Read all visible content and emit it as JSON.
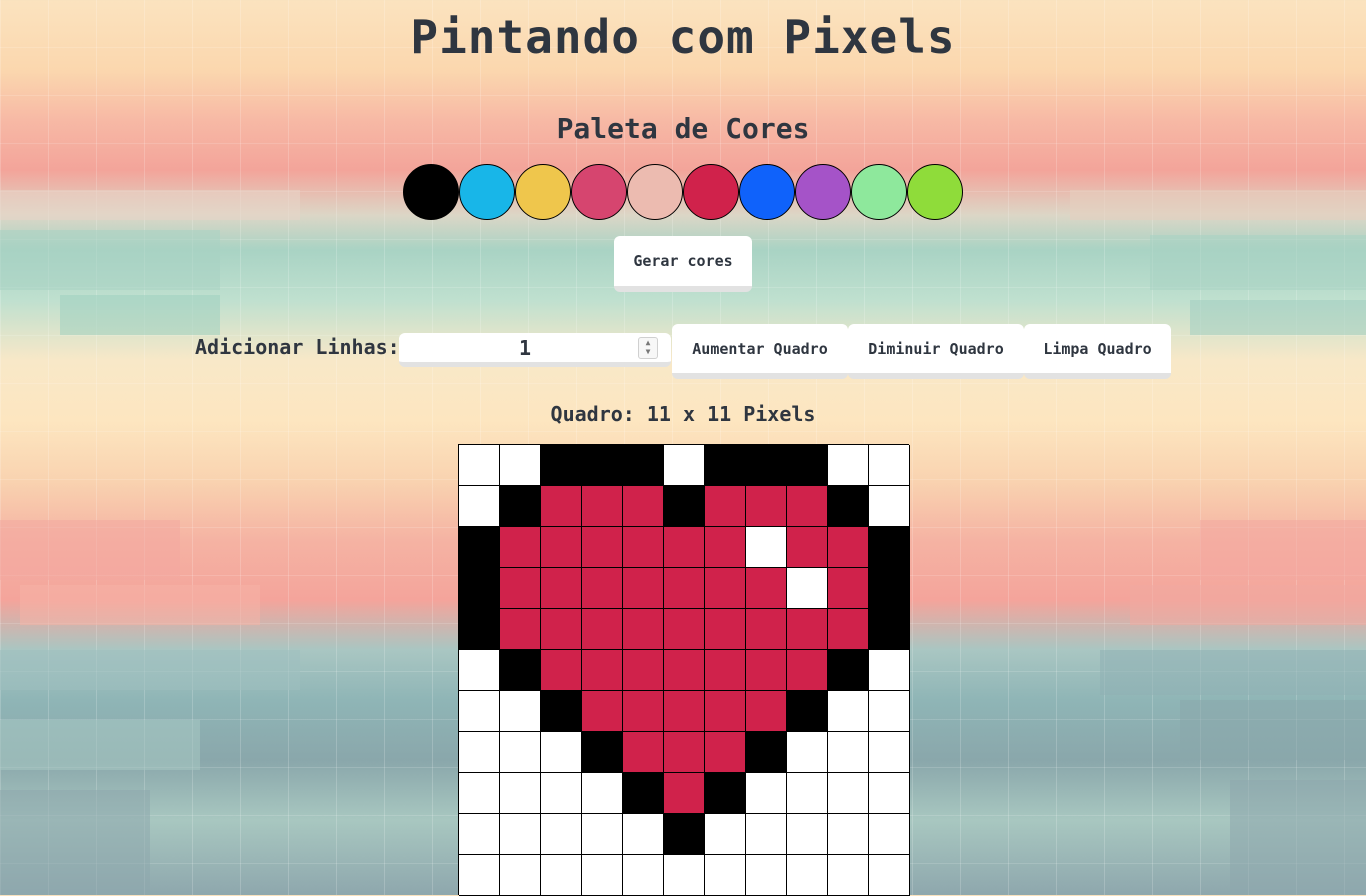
{
  "page_title": "Pintando com Pixels",
  "palette": {
    "title": "Paleta de Cores",
    "colors": [
      "#000000",
      "#18b6e8",
      "#efc64c",
      "#d6456f",
      "#ecbbb0",
      "#d0224b",
      "#0f62fb",
      "#a553c8",
      "#8ee89c",
      "#8fdc3a"
    ]
  },
  "generate_button_label": "Gerar cores",
  "controls": {
    "rows_label": "Adicionar Linhas:",
    "rows_value": "1",
    "increase_label": "Aumentar Quadro",
    "decrease_label": "Diminuir Quadro",
    "clear_label": "Limpa Quadro"
  },
  "board": {
    "title": "Quadro: 11 x 11 Pixels",
    "size": 11,
    "colors": {
      "W": "#ffffff",
      "K": "#000000",
      "R": "#d0224b"
    },
    "grid": [
      "WWKKKWKKKWW",
      "WKRRRKRRRKW",
      "KRRRRRRWRRK",
      "KRRRRRRRWRK",
      "KRRRRRRRRRK",
      "WKRRRRRRRKW",
      "WWKRRRRRKWW",
      "WWWKRRRKWWW",
      "WWWWKRKWWWW",
      "WWWWWKWWWWW",
      "WWWWWWWWWWW"
    ]
  }
}
